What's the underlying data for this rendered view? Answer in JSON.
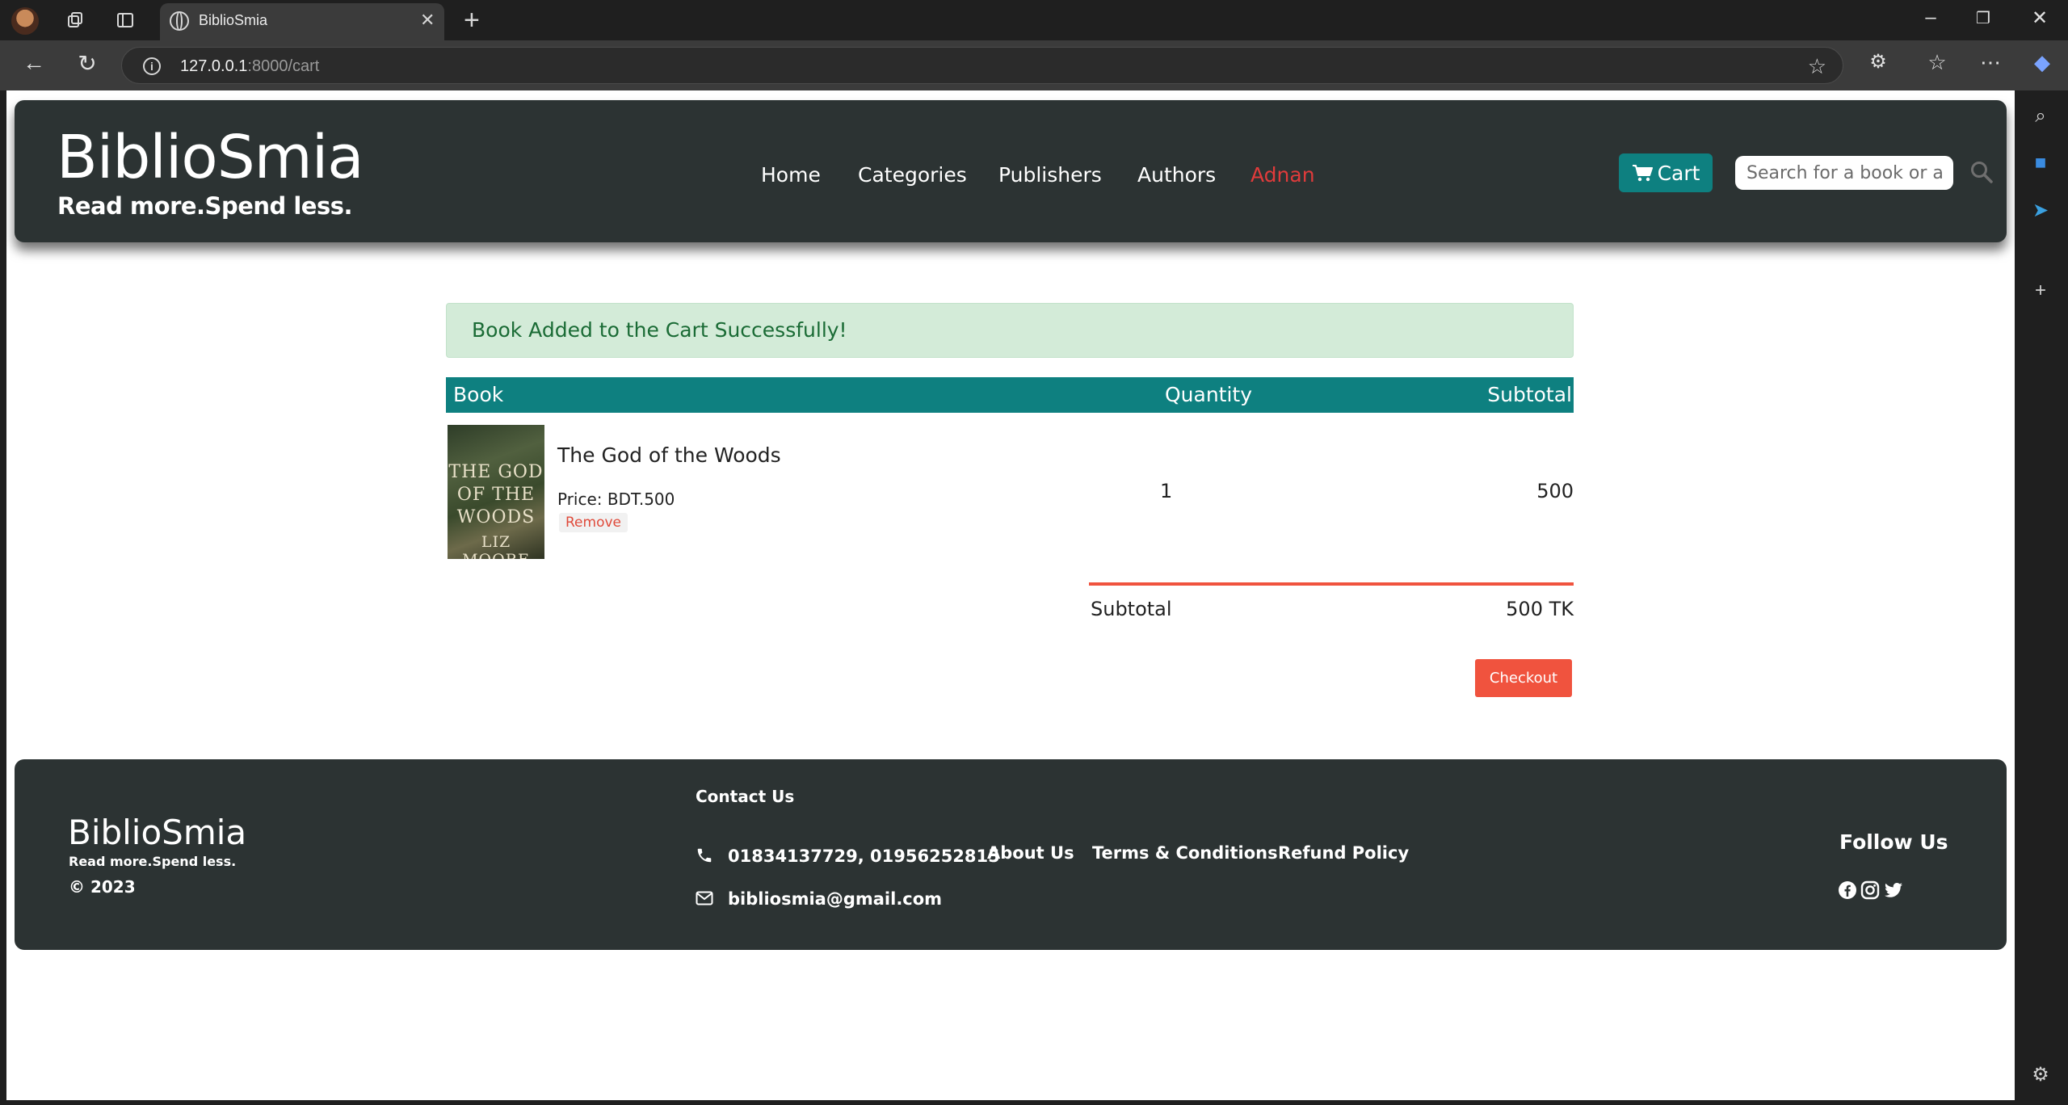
{
  "browser": {
    "tab_title": "BiblioSmia",
    "url_host": "127.0.0.1",
    "url_path": ":8000/cart"
  },
  "header": {
    "logo": "BiblioSmia",
    "tagline": "Read more.Spend less.",
    "nav": [
      "Home",
      "Categories",
      "Publishers",
      "Authors",
      "Adnan"
    ],
    "cart_label": "Cart",
    "search_placeholder": "Search for a book or author"
  },
  "alert": {
    "message": "Book Added to the Cart Successfully!"
  },
  "cart": {
    "columns": [
      "Book",
      "Quantity",
      "Subtotal"
    ],
    "items": [
      {
        "title": "The God of the Woods",
        "price": "Price: BDT.500",
        "remove_label": "Remove",
        "quantity": "1",
        "subtotal": "500",
        "cover_text": [
          "THE GOD",
          "OF THE",
          "WOODS",
          "LIZ MOORE"
        ]
      }
    ],
    "summary_label": "Subtotal",
    "summary_value": "500 TK",
    "checkout_label": "Checkout"
  },
  "footer": {
    "logo": "BiblioSmia",
    "tagline": "Read more.Spend less.",
    "copyright": "© 2023",
    "contact_title": "Contact Us",
    "phone": "01834137729, 01956252815",
    "email": "bibliosmia@gmail.com",
    "links": [
      "About Us",
      "Terms & Conditions",
      "Refund Policy"
    ],
    "follow_title": "Follow Us",
    "social_icons": [
      "facebook-icon",
      "instagram-icon",
      "twitter-icon"
    ]
  },
  "colors": {
    "header_bg": "#2c3333",
    "accent_teal": "#0e8080",
    "accent_red": "#f0533e",
    "active_nav": "#e03b3b",
    "alert_bg": "#d3ebd8"
  }
}
